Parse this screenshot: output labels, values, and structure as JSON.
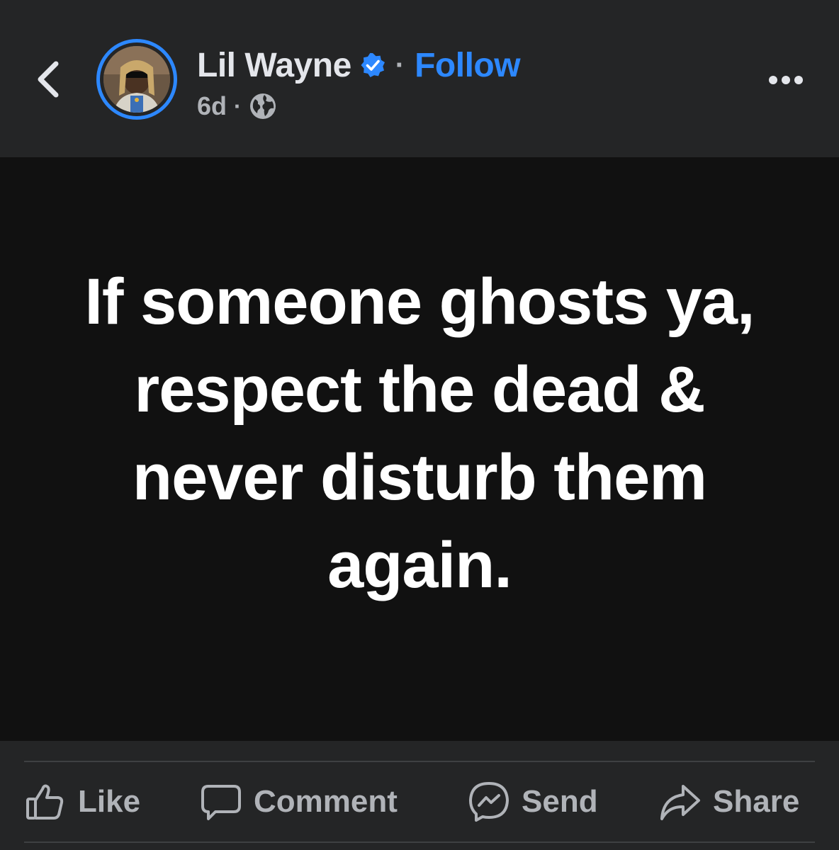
{
  "header": {
    "back_icon": "chevron-left-icon",
    "author_name": "Lil Wayne",
    "verified_icon": "verified-badge-icon",
    "separator": "·",
    "follow_label": "Follow",
    "timestamp": "6d",
    "meta_separator": "·",
    "audience_icon": "globe-icon",
    "more_icon": "more-horizontal-icon"
  },
  "post": {
    "text": "If someone ghosts ya, respect the dead & never disturb them again."
  },
  "actions": [
    {
      "label": "Like",
      "icon": "thumbs-up-icon"
    },
    {
      "label": "Comment",
      "icon": "comment-bubble-icon"
    },
    {
      "label": "Send",
      "icon": "messenger-icon"
    },
    {
      "label": "Share",
      "icon": "share-arrow-icon"
    }
  ],
  "colors": {
    "background": "#242526",
    "post_background": "#111111",
    "accent": "#2d88ff",
    "primary_text": "#e4e6eb",
    "secondary_text": "#b0b3b8"
  }
}
